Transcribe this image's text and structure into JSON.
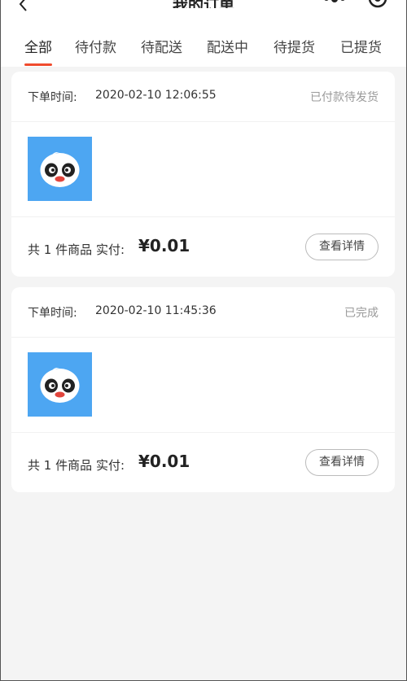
{
  "header": {
    "title": "我的订单",
    "back_icon": "chevron-left-icon",
    "more_icon": "more-dots-icon",
    "close_icon": "target-close-icon"
  },
  "tabs": [
    {
      "label": "全部",
      "active": true
    },
    {
      "label": "待付款"
    },
    {
      "label": "待配送"
    },
    {
      "label": "配送中"
    },
    {
      "label": "待提货"
    },
    {
      "label": "已提货"
    }
  ],
  "colors": {
    "accent": "#f04b2d",
    "thumb_bg": "#4da6f2",
    "status_gray": "#9a9a9a"
  },
  "orders": [
    {
      "time_label": "下单时间:",
      "time_value": "2020-02-10 12:06:55",
      "status": "已付款待发货",
      "count_text": "共 1 件商品",
      "paid_label": "实付:",
      "price": "¥0.01",
      "detail_label": "查看详情",
      "thumb_icon": "panda-icon"
    },
    {
      "time_label": "下单时间:",
      "time_value": "2020-02-10 11:45:36",
      "status": "已完成",
      "count_text": "共 1 件商品",
      "paid_label": "实付:",
      "price": "¥0.01",
      "detail_label": "查看详情",
      "thumb_icon": "panda-icon"
    }
  ]
}
